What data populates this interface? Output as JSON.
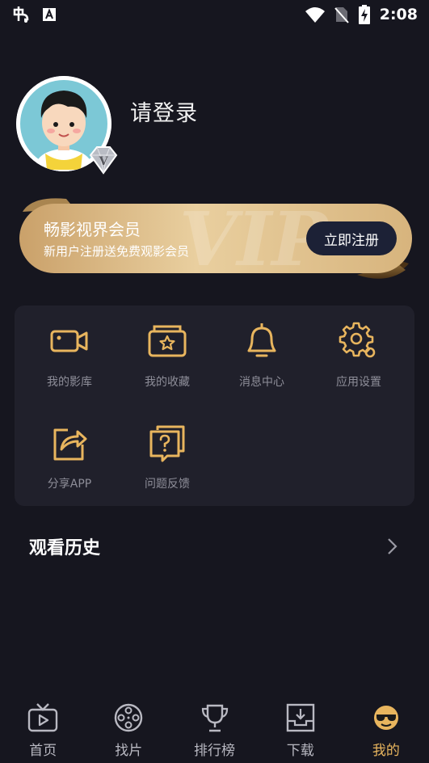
{
  "status_bar": {
    "time": "2:08",
    "left_icons": [
      "app-logo-icon",
      "a-icon"
    ],
    "right_icons": [
      "wifi-icon",
      "no-sim-icon",
      "battery-charging-icon"
    ]
  },
  "profile": {
    "login_text": "请登录",
    "vip_badge": "V"
  },
  "vip_banner": {
    "title": "畅影视界会员",
    "subtitle": "新用户注册送免费观影会员",
    "button": "立即注册",
    "watermark": "VIP"
  },
  "menu": {
    "items": [
      {
        "label": "我的影库",
        "icon": "video-camera-icon"
      },
      {
        "label": "我的收藏",
        "icon": "star-folder-icon"
      },
      {
        "label": "消息中心",
        "icon": "bell-icon"
      },
      {
        "label": "应用设置",
        "icon": "gear-icon"
      },
      {
        "label": "分享APP",
        "icon": "share-icon"
      },
      {
        "label": "问题反馈",
        "icon": "question-icon"
      }
    ]
  },
  "history": {
    "title": "观看历史"
  },
  "bottom_nav": {
    "items": [
      {
        "label": "首页",
        "icon": "tv-icon"
      },
      {
        "label": "找片",
        "icon": "film-reel-icon"
      },
      {
        "label": "排行榜",
        "icon": "trophy-icon"
      },
      {
        "label": "下载",
        "icon": "download-icon"
      },
      {
        "label": "我的",
        "icon": "cool-face-icon",
        "active": true
      }
    ]
  },
  "colors": {
    "background": "#16161f",
    "card": "#20202b",
    "accent": "#e8b55e",
    "gold": "#d9b97e"
  }
}
